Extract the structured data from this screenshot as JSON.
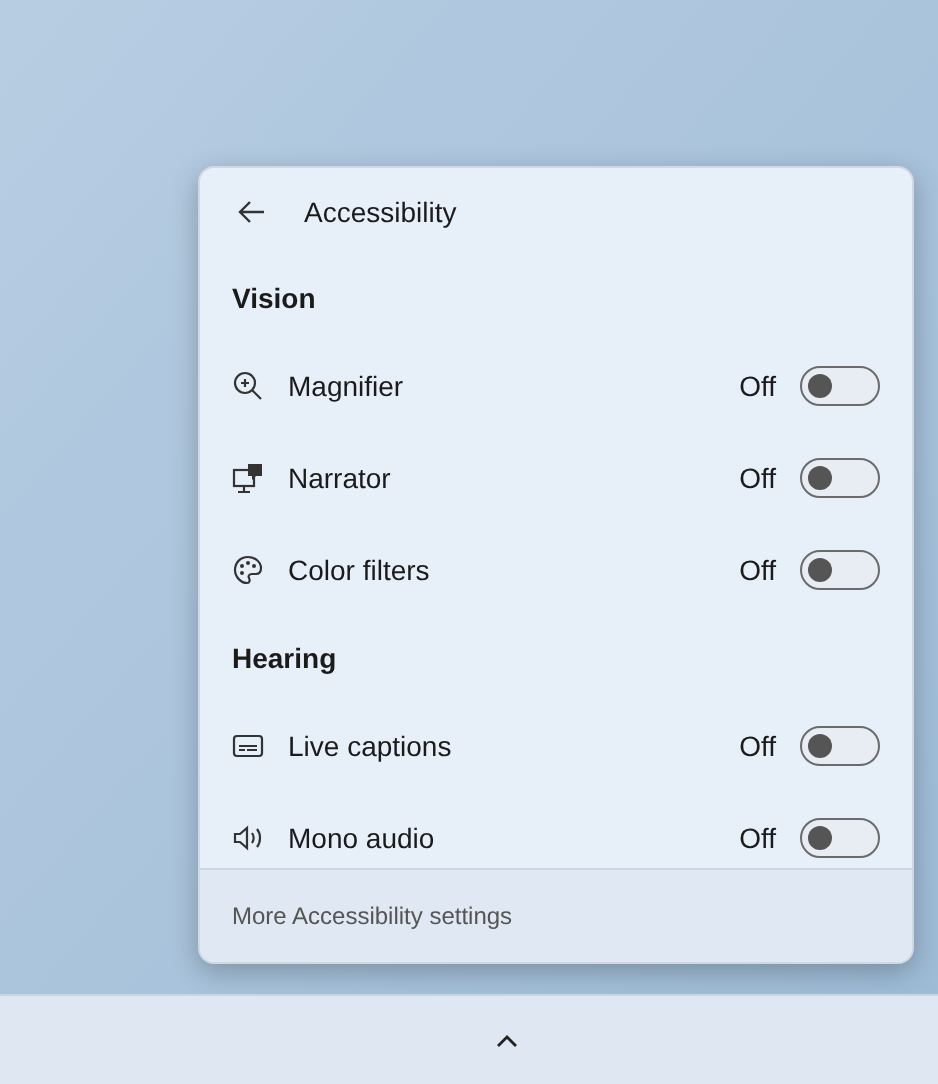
{
  "panel": {
    "title": "Accessibility",
    "sections": [
      {
        "heading": "Vision",
        "items": [
          {
            "label": "Magnifier",
            "state": "Off",
            "on": false
          },
          {
            "label": "Narrator",
            "state": "Off",
            "on": false
          },
          {
            "label": "Color filters",
            "state": "Off",
            "on": false
          }
        ]
      },
      {
        "heading": "Hearing",
        "items": [
          {
            "label": "Live captions",
            "state": "Off",
            "on": false
          },
          {
            "label": "Mono audio",
            "state": "Off",
            "on": false
          }
        ]
      }
    ],
    "footer_link": "More Accessibility settings"
  }
}
